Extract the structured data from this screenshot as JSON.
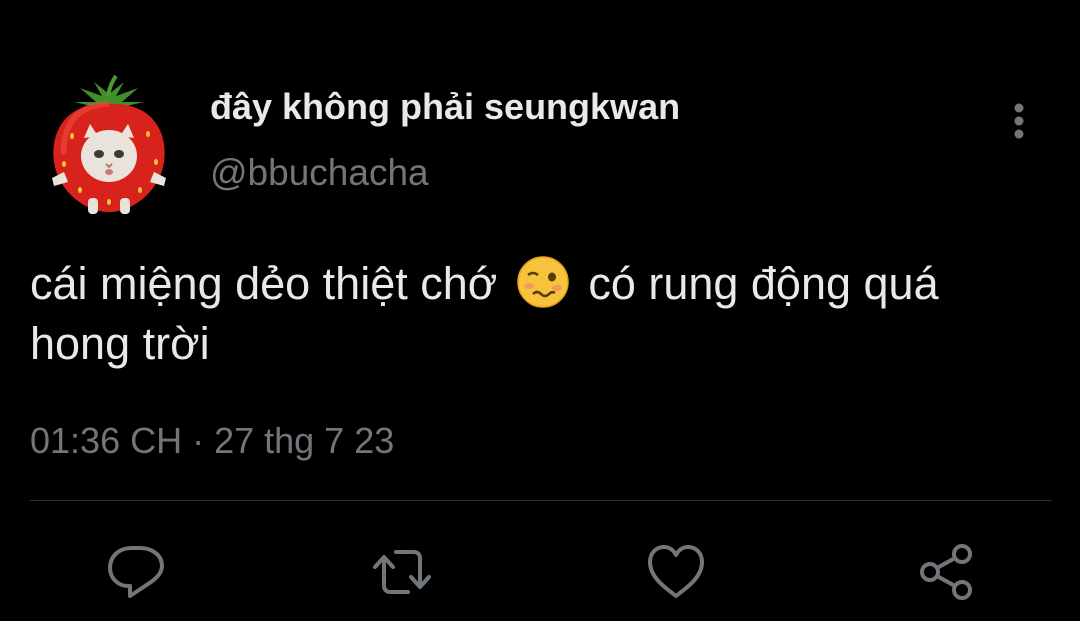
{
  "tweet": {
    "display_name": "đây không phải seungkwan",
    "handle": "@bbuchacha",
    "text_part1": "cái miệng dẻo thiệt chớ",
    "emoji_icon": "woozy-face-icon",
    "text_part2": "có rung động quá hong trời",
    "timestamp": "01:36 CH · 27 thg 7 23"
  },
  "actions": {
    "icons": [
      "reply-icon",
      "retweet-icon",
      "like-icon",
      "share-icon"
    ]
  },
  "colors": {
    "background": "#000000",
    "text_primary": "#e7e9ea",
    "text_secondary": "#71767b",
    "divider": "#2f3336"
  }
}
